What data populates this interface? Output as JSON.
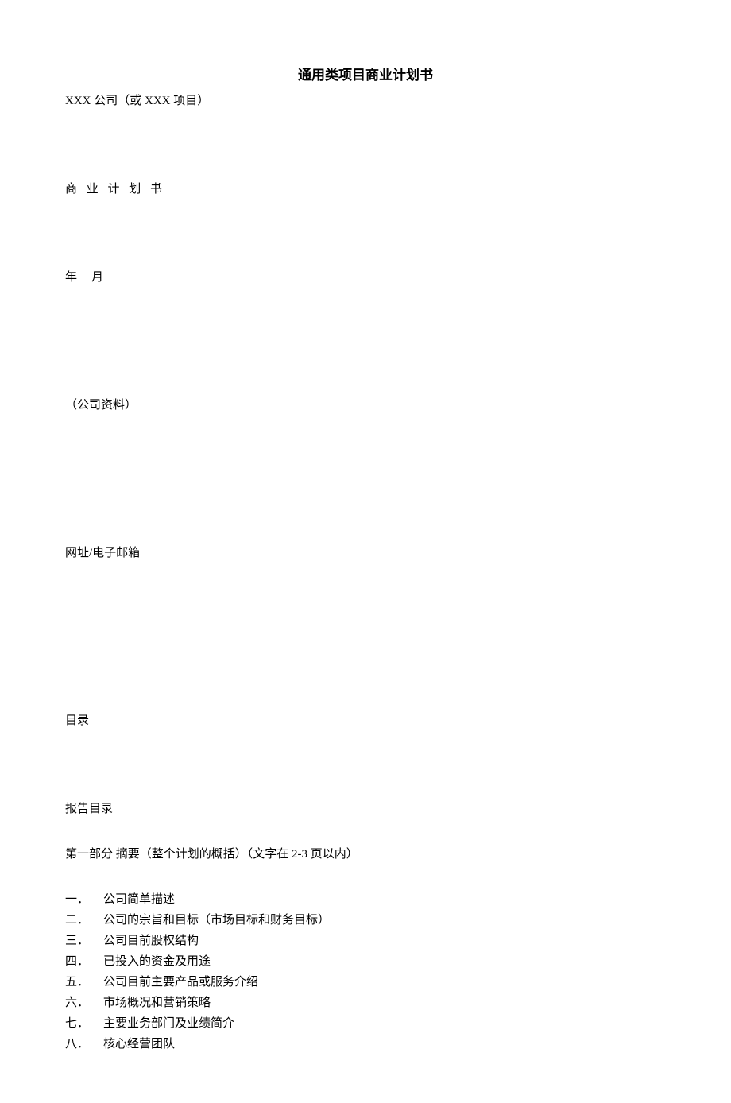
{
  "title": "通用类项目商业计划书",
  "subtitle": "XXX 公司（或 XXX 项目）",
  "plan_heading": "商 业 计 划 书",
  "date_year": "年",
  "date_month": "月",
  "company_info_label": "（公司资料）",
  "web_email_label": "网址/电子邮箱",
  "toc_label": "目录",
  "report_toc_label": "报告目录",
  "section1_header": "第一部分 摘要（整个计划的概括）（文字在 2-3 页以内）",
  "toc_items": [
    {
      "num": "一．",
      "text": "公司简单描述"
    },
    {
      "num": "二．",
      "text": "公司的宗旨和目标（市场目标和财务目标）"
    },
    {
      "num": "三．",
      "text": "公司目前股权结构"
    },
    {
      "num": "四．",
      "text": "已投入的资金及用途"
    },
    {
      "num": "五．",
      "text": "公司目前主要产品或服务介绍"
    },
    {
      "num": "六．",
      "text": "市场概况和营销策略"
    },
    {
      "num": "七．",
      "text": "主要业务部门及业绩简介"
    },
    {
      "num": "八．",
      "text": "核心经营团队"
    }
  ]
}
